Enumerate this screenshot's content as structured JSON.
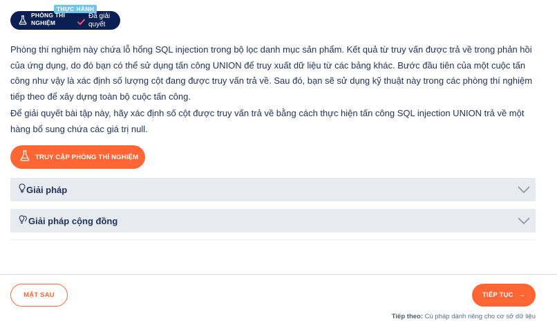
{
  "badge": {
    "label": "PHÒNG THÍ NGHIỆM",
    "tag": "THỰC HÀNH",
    "status": "Đã giải quyết"
  },
  "description": {
    "para1": "Phòng thí nghiệm này chứa lỗ hổng SQL injection trong bộ lọc danh mục sản phẩm. Kết quả từ truy vấn được trả về trong phản hồi của ứng dụng, do đó bạn có thể sử dụng tấn công UNION để truy xuất dữ liệu từ các bảng khác. Bước đầu tiên của một cuộc tấn công như vậy là xác định số lượng cột đang được truy vấn trả về. Sau đó, bạn sẽ sử dụng kỹ thuật này trong các phòng thí nghiệm tiếp theo để xây dựng toàn bộ cuộc tấn công.",
    "para2": "Để giải quyết bài tập này, hãy xác định số cột được truy vấn trả về bằng cách thực hiện tấn công SQL injection UNION trả về một hàng bổ sung chứa các giá trị null."
  },
  "access_button": {
    "label": "TRUY CẬP PHÒNG THÍ NGHIỆM",
    "icon": "flask-icon"
  },
  "accordions": [
    {
      "title": "Giải pháp",
      "icon": "lightbulb-icon"
    },
    {
      "title": "Giải pháp cộng đồng",
      "icon": "lightbulbs-icon"
    }
  ],
  "footer": {
    "back_label": "MẶT SAU",
    "next_label": "TIẾP TỤC",
    "next_arrow": "→",
    "next_hint_prefix": "Tiếp theo:",
    "next_hint_text": " Cú pháp dành riêng cho cơ sở dữ liệu"
  },
  "colors": {
    "accent": "#ff6633",
    "navy": "#0b1f52",
    "tag": "#6fc6ea",
    "accordion_bg": "#e7eaee",
    "text": "#21335a"
  }
}
